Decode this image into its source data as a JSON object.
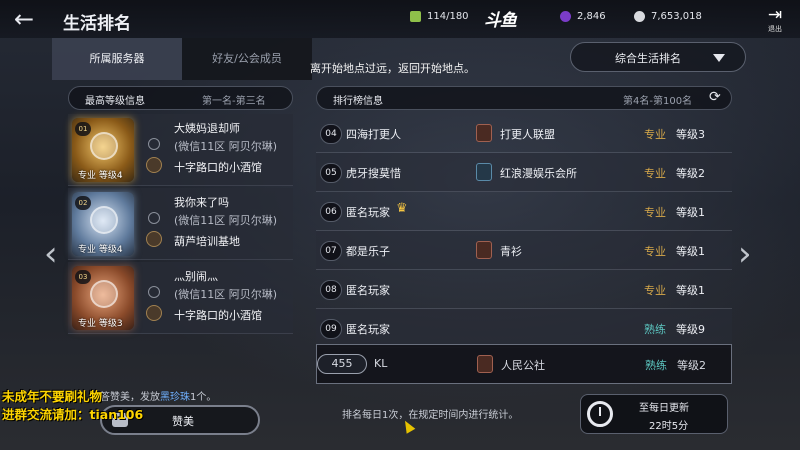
{
  "header": {
    "title": "生活排名",
    "energy": "114/180",
    "logo": "斗鱼",
    "gems": "2,846",
    "silver": "7,653,018",
    "exit_label": "退出"
  },
  "tabs": [
    {
      "label": "所属服务器",
      "active": true
    },
    {
      "label": "好友/公会成员",
      "active": false
    }
  ],
  "notice": "离开始地点过远，返回开始地点。",
  "sort_dropdown": {
    "selected": "综合生活排名"
  },
  "left_panel": {
    "title": "最高等级信息",
    "range": "第一名-第三名",
    "entries": [
      {
        "rank": "01",
        "caption": "专业  等级4",
        "name": "大姨妈退却师",
        "server": "(微信11区 阿贝尔琳)",
        "guild": "十字路口的小酒馆"
      },
      {
        "rank": "02",
        "caption": "专业  等级4",
        "name": "我你来了吗",
        "server": "(微信11区 阿贝尔琳)",
        "guild": "葫芦培训基地"
      },
      {
        "rank": "03",
        "caption": "专业  等级3",
        "name": "灬别闹灬",
        "server": "(微信11区 阿贝尔琳)",
        "guild": "十字路口的小酒馆"
      }
    ]
  },
  "right_panel": {
    "title": "排行榜信息",
    "range": "第4名-第100名",
    "rows": [
      {
        "rank": "04",
        "name": "四海打更人",
        "crown": false,
        "guild": "打更人联盟",
        "tier": "专业",
        "tier_type": "pro",
        "level": "等级3"
      },
      {
        "rank": "05",
        "name": "虎牙搜莫惜",
        "crown": false,
        "guild": "红浪漫娱乐会所",
        "tier": "专业",
        "tier_type": "pro",
        "level": "等级2"
      },
      {
        "rank": "06",
        "name": "匿名玩家",
        "crown": true,
        "guild": "",
        "tier": "专业",
        "tier_type": "pro",
        "level": "等级1"
      },
      {
        "rank": "07",
        "name": "都是乐子",
        "crown": false,
        "guild": "青衫",
        "tier": "专业",
        "tier_type": "pro",
        "level": "等级1"
      },
      {
        "rank": "08",
        "name": "匿名玩家",
        "crown": false,
        "guild": "",
        "tier": "专业",
        "tier_type": "pro",
        "level": "等级1"
      },
      {
        "rank": "09",
        "name": "匿名玩家",
        "crown": false,
        "guild": "",
        "tier": "熟练",
        "tier_type": "skill",
        "level": "等级9"
      }
    ],
    "my_row": {
      "rank": "455",
      "name": "KL",
      "guild": "人民公社",
      "tier": "熟练",
      "level": "等级2"
    }
  },
  "ticker": {
    "prefix": "答赞美，发放",
    "highlight": "黑珍珠",
    "suffix": "1个。"
  },
  "praise_button": "赞美",
  "overlay": {
    "line1": "未成年不要刷礼物",
    "line2": "进群交流请加：tian106"
  },
  "footnote": "排名每日1次，在规定时间内进行统计。",
  "timer": {
    "line1": "至每日更新",
    "line2": "22时5分"
  },
  "nav": {
    "prev": "‹",
    "next": "›"
  }
}
